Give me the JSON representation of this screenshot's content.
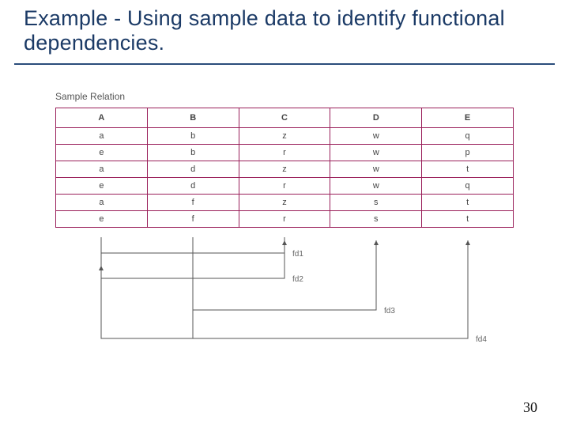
{
  "title": "Example - Using sample data to identify functional dependencies.",
  "caption": "Sample Relation",
  "headers": [
    "A",
    "B",
    "C",
    "D",
    "E"
  ],
  "rows": [
    [
      "a",
      "b",
      "z",
      "w",
      "q"
    ],
    [
      "e",
      "b",
      "r",
      "w",
      "p"
    ],
    [
      "a",
      "d",
      "z",
      "w",
      "t"
    ],
    [
      "e",
      "d",
      "r",
      "w",
      "q"
    ],
    [
      "a",
      "f",
      "z",
      "s",
      "t"
    ],
    [
      "e",
      "f",
      "r",
      "s",
      "t"
    ]
  ],
  "chart_data": {
    "type": "table",
    "title": "Sample Relation",
    "columns": [
      "A",
      "B",
      "C",
      "D",
      "E"
    ],
    "data": [
      [
        "a",
        "b",
        "z",
        "w",
        "q"
      ],
      [
        "e",
        "b",
        "r",
        "w",
        "p"
      ],
      [
        "a",
        "d",
        "z",
        "w",
        "t"
      ],
      [
        "e",
        "d",
        "r",
        "w",
        "q"
      ],
      [
        "a",
        "f",
        "z",
        "s",
        "t"
      ],
      [
        "e",
        "f",
        "r",
        "s",
        "t"
      ]
    ],
    "dependencies": [
      {
        "name": "fd1",
        "from": [
          "A"
        ],
        "to": [
          "C"
        ]
      },
      {
        "name": "fd2",
        "from": [
          "C"
        ],
        "to": [
          "A"
        ]
      },
      {
        "name": "fd3",
        "from": [
          "B"
        ],
        "to": [
          "D"
        ]
      },
      {
        "name": "fd4",
        "from": [
          "A",
          "B"
        ],
        "to": [
          "E"
        ]
      }
    ]
  },
  "fds": [
    {
      "label": "fd1"
    },
    {
      "label": "fd2"
    },
    {
      "label": "fd3"
    },
    {
      "label": "fd4"
    }
  ],
  "page_number": "30"
}
